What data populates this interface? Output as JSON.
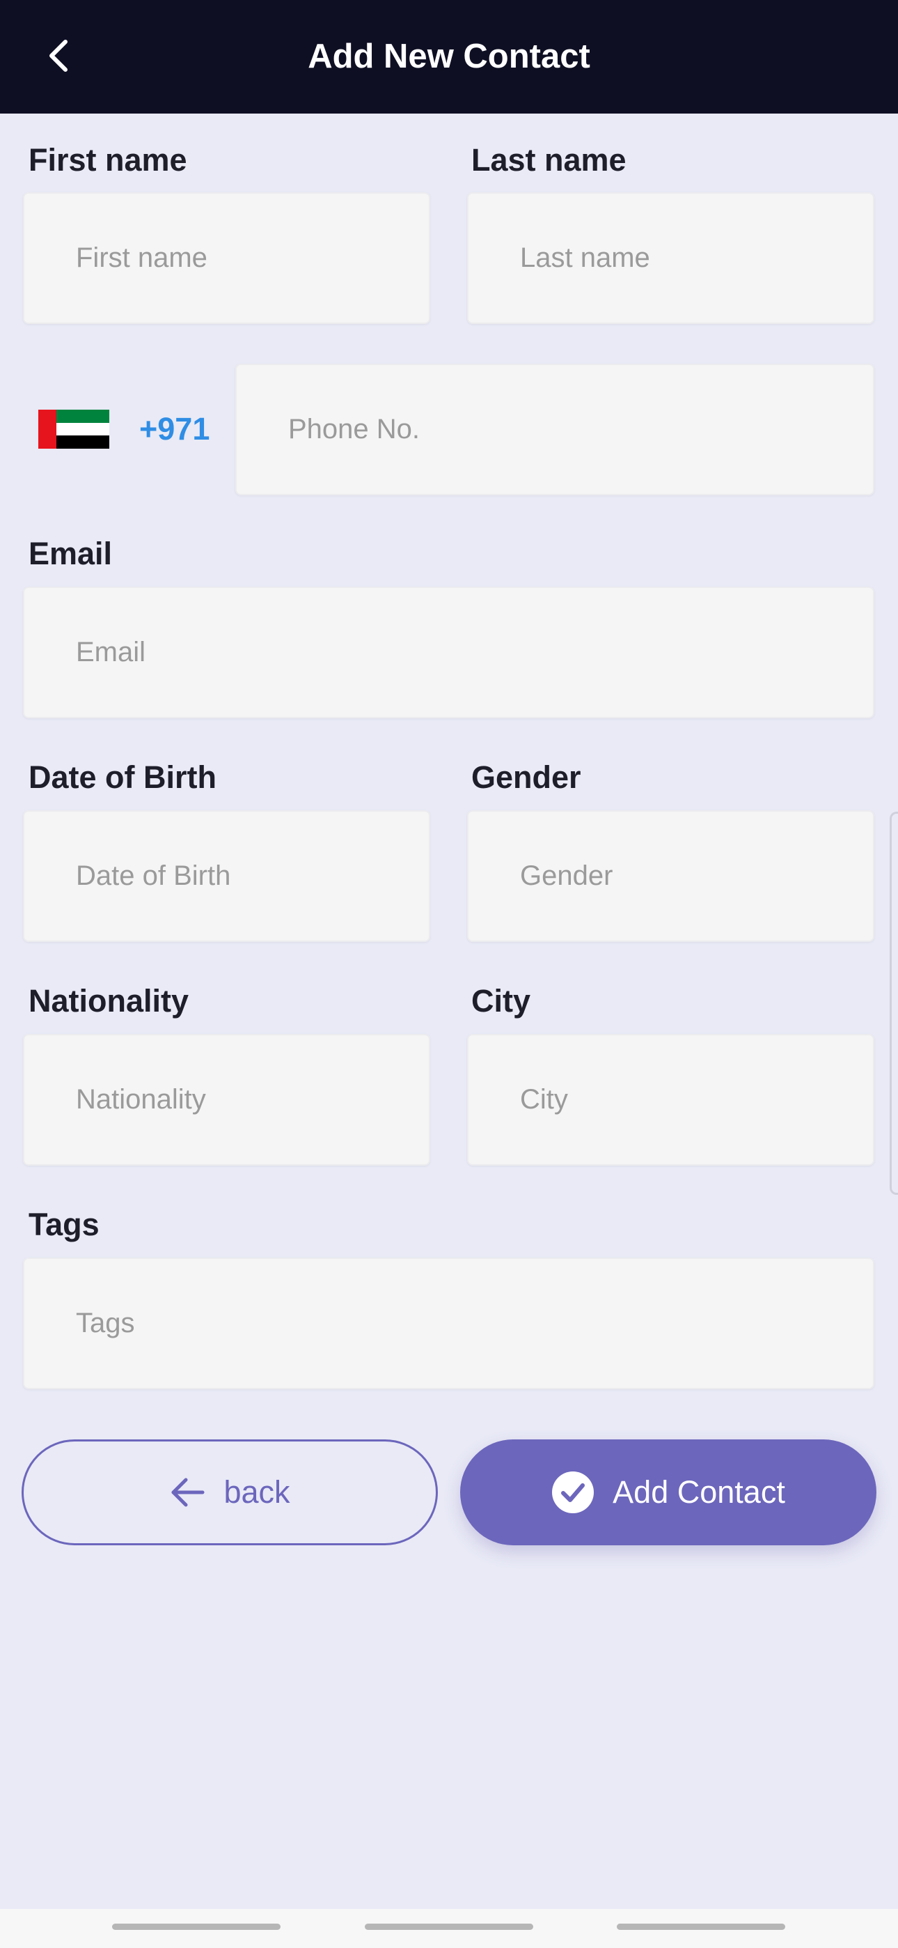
{
  "header": {
    "title": "Add New Contact"
  },
  "form": {
    "first_name": {
      "label": "First name",
      "placeholder": "First name"
    },
    "last_name": {
      "label": "Last name",
      "placeholder": "Last name"
    },
    "phone": {
      "country_code": "+971",
      "placeholder": "Phone No.",
      "flag_icon": "uae-flag-icon"
    },
    "email": {
      "label": "Email",
      "placeholder": "Email"
    },
    "dob": {
      "label": "Date of Birth",
      "placeholder": "Date of Birth"
    },
    "gender": {
      "label": "Gender",
      "placeholder": "Gender"
    },
    "nationality": {
      "label": "Nationality",
      "placeholder": "Nationality"
    },
    "city": {
      "label": "City",
      "placeholder": "City"
    },
    "tags": {
      "label": "Tags",
      "placeholder": "Tags"
    }
  },
  "actions": {
    "back_label": "back",
    "add_label": "Add Contact"
  },
  "colors": {
    "header_bg": "#0f0f24",
    "page_bg": "#e9eaf6",
    "accent": "#6c66bc",
    "country_code": "#2f8de4"
  }
}
